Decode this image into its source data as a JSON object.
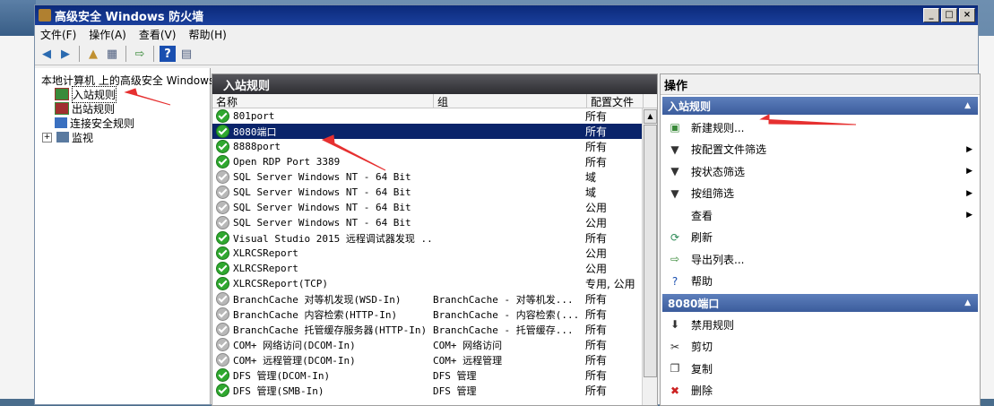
{
  "window": {
    "title": "高级安全 Windows 防火墙",
    "buttons": [
      "_",
      "□",
      "×"
    ]
  },
  "menu": [
    "文件(F)",
    "操作(A)",
    "查看(V)",
    "帮助(H)"
  ],
  "tree": [
    {
      "label": "本地计算机 上的高级安全 Windows",
      "level": 0
    },
    {
      "label": "入站规则",
      "level": 1
    },
    {
      "label": "出站规则",
      "level": 1
    },
    {
      "label": "连接安全规则",
      "level": 1
    },
    {
      "label": "监视",
      "level": 1
    }
  ],
  "center": {
    "title": "入站规则",
    "columns": [
      "名称",
      "组",
      "配置文件"
    ],
    "rows": [
      {
        "name": "801port",
        "group": "",
        "profile": "所有",
        "enabled": true
      },
      {
        "name": "8080端口",
        "group": "",
        "profile": "所有",
        "enabled": true,
        "selected": true
      },
      {
        "name": "8888port",
        "group": "",
        "profile": "所有",
        "enabled": true
      },
      {
        "name": "Open RDP Port 3389",
        "group": "",
        "profile": "所有",
        "enabled": true
      },
      {
        "name": "SQL Server Windows NT - 64 Bit",
        "group": "",
        "profile": "域",
        "enabled": false
      },
      {
        "name": "SQL Server Windows NT - 64 Bit",
        "group": "",
        "profile": "域",
        "enabled": false
      },
      {
        "name": "SQL Server Windows NT - 64 Bit",
        "group": "",
        "profile": "公用",
        "enabled": false
      },
      {
        "name": "SQL Server Windows NT - 64 Bit",
        "group": "",
        "profile": "公用",
        "enabled": false
      },
      {
        "name": "Visual Studio 2015 远程调试器发现 ...",
        "group": "",
        "profile": "所有",
        "enabled": true
      },
      {
        "name": "XLRCSReport",
        "group": "",
        "profile": "公用",
        "enabled": true
      },
      {
        "name": "XLRCSReport",
        "group": "",
        "profile": "公用",
        "enabled": true
      },
      {
        "name": "XLRCSReport(TCP)",
        "group": "",
        "profile": "专用, 公用",
        "enabled": true
      },
      {
        "name": "BranchCache 对等机发现(WSD-In)",
        "group": "BranchCache - 对等机发...",
        "profile": "所有",
        "enabled": false
      },
      {
        "name": "BranchCache 内容检索(HTTP-In)",
        "group": "BranchCache - 内容检索(...",
        "profile": "所有",
        "enabled": false
      },
      {
        "name": "BranchCache 托管缓存服务器(HTTP-In)",
        "group": "BranchCache - 托管缓存...",
        "profile": "所有",
        "enabled": false
      },
      {
        "name": "COM+ 网络访问(DCOM-In)",
        "group": "COM+ 网络访问",
        "profile": "所有",
        "enabled": false
      },
      {
        "name": "COM+ 远程管理(DCOM-In)",
        "group": "COM+ 远程管理",
        "profile": "所有",
        "enabled": false
      },
      {
        "name": "DFS 管理(DCOM-In)",
        "group": "DFS 管理",
        "profile": "所有",
        "enabled": true
      },
      {
        "name": "DFS 管理(SMB-In)",
        "group": "DFS 管理",
        "profile": "所有",
        "enabled": true
      }
    ]
  },
  "actions": {
    "title": "操作",
    "section1": "入站规则",
    "items1": [
      {
        "label": "新建规则...",
        "icon": "new-rule-icon",
        "glyph": "▣",
        "color": "#3a8a3a",
        "submenu": false
      },
      {
        "label": "按配置文件筛选",
        "icon": "filter-icon",
        "glyph": "▼",
        "color": "#333333",
        "submenu": true
      },
      {
        "label": "按状态筛选",
        "icon": "filter-icon",
        "glyph": "▼",
        "color": "#333333",
        "submenu": true
      },
      {
        "label": "按组筛选",
        "icon": "filter-icon",
        "glyph": "▼",
        "color": "#333333",
        "submenu": true
      },
      {
        "label": "查看",
        "icon": "",
        "glyph": "",
        "color": "#333333",
        "submenu": true
      },
      {
        "label": "刷新",
        "icon": "refresh-icon",
        "glyph": "⟳",
        "color": "#2e8b57",
        "submenu": false
      },
      {
        "label": "导出列表...",
        "icon": "export-icon",
        "glyph": "⇨",
        "color": "#3a8a3a",
        "submenu": false
      },
      {
        "label": "帮助",
        "icon": "help-icon",
        "glyph": "?",
        "color": "#1a4fb0",
        "submenu": false
      }
    ],
    "section2": "8080端口",
    "items2": [
      {
        "label": "禁用规则",
        "icon": "disable-icon",
        "glyph": "⬇",
        "color": "#333333"
      },
      {
        "label": "剪切",
        "icon": "cut-icon",
        "glyph": "✂",
        "color": "#333333"
      },
      {
        "label": "复制",
        "icon": "copy-icon",
        "glyph": "❐",
        "color": "#333333"
      },
      {
        "label": "删除",
        "icon": "delete-icon",
        "glyph": "✖",
        "color": "#cc2222"
      }
    ]
  }
}
